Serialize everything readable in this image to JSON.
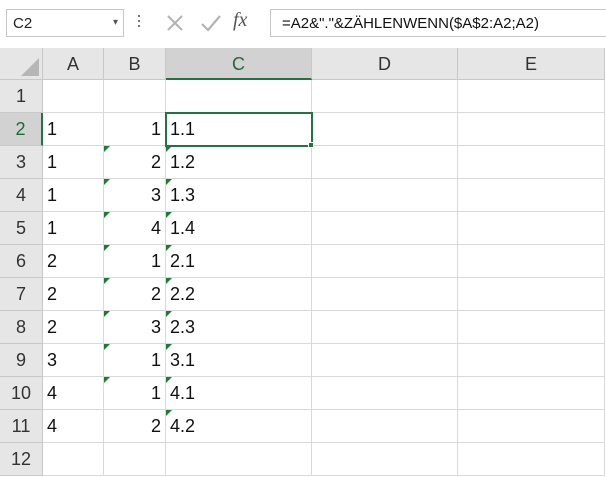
{
  "formula_bar": {
    "name_box": "C2",
    "name_box_arrow": "▾",
    "cancel_glyph": "✕",
    "enter_glyph": "✓",
    "fx_label": "fx",
    "formula": "=A2&\".\"&ZÄHLENWENN($A$2:A2;A2)"
  },
  "columns": [
    "A",
    "B",
    "C",
    "D",
    "E"
  ],
  "rows": [
    "1",
    "2",
    "3",
    "4",
    "5",
    "6",
    "7",
    "8",
    "9",
    "10",
    "11",
    "12"
  ],
  "selected_cell": "C2",
  "accent_color": "#217346",
  "error_flag_color": "#1e7b34",
  "cells": {
    "A": [
      "",
      "1",
      "1",
      "1",
      "1",
      "2",
      "2",
      "2",
      "3",
      "4",
      "4",
      ""
    ],
    "B": [
      "",
      "1",
      "2",
      "3",
      "4",
      "1",
      "2",
      "3",
      "1",
      "1",
      "2",
      ""
    ],
    "C": [
      "",
      "1.1",
      "1.2",
      "1.3",
      "1.4",
      "2.1",
      "2.2",
      "2.3",
      "3.1",
      "4.1",
      "4.2",
      ""
    ],
    "D": [
      "",
      "",
      "",
      "",
      "",
      "",
      "",
      "",
      "",
      "",
      "",
      ""
    ],
    "E": [
      "",
      "",
      "",
      "",
      "",
      "",
      "",
      "",
      "",
      "",
      "",
      ""
    ]
  },
  "error_flags": {
    "B": [
      false,
      false,
      true,
      true,
      true,
      true,
      true,
      true,
      true,
      true,
      false,
      false
    ],
    "C": [
      false,
      false,
      true,
      true,
      true,
      true,
      true,
      true,
      true,
      true,
      true,
      false
    ]
  },
  "icons": {
    "name_box_dropdown": "chevron-down-icon",
    "cancel": "close-icon",
    "enter": "checkmark-icon",
    "insert_function": "fx-icon"
  }
}
